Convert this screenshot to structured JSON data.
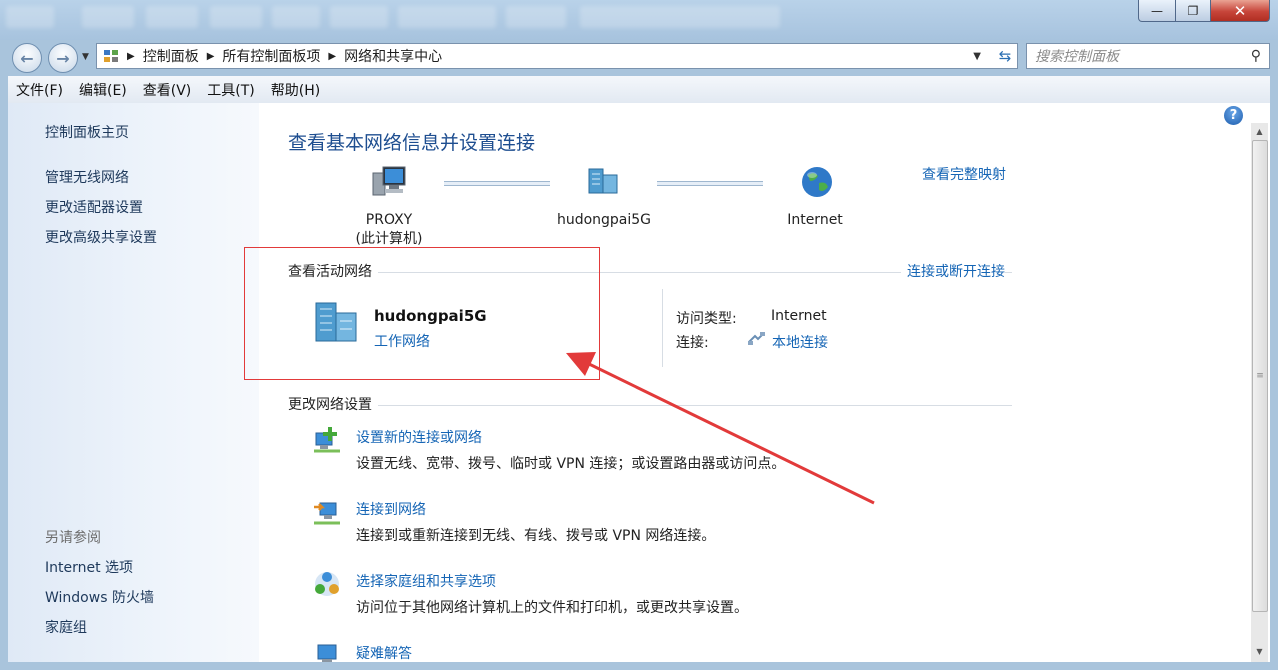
{
  "window": {
    "min_label": "—",
    "max_label": "❐",
    "close_label": "✕"
  },
  "nav": {
    "back_icon": "back-arrow-icon",
    "forward_icon": "forward-arrow-icon",
    "breadcrumbs": [
      "控制面板",
      "所有控制面板项",
      "网络和共享中心"
    ],
    "search_placeholder": "搜索控制面板"
  },
  "menu": [
    "文件(F)",
    "编辑(E)",
    "查看(V)",
    "工具(T)",
    "帮助(H)"
  ],
  "sidebar": {
    "home": "控制面板主页",
    "links": [
      "管理无线网络",
      "更改适配器设置",
      "更改高级共享设置"
    ],
    "see_also_heading": "另请参阅",
    "see_also": [
      "Internet 选项",
      "Windows 防火墙",
      "家庭组"
    ]
  },
  "main": {
    "title": "查看基本网络信息并设置连接",
    "full_map_link": "查看完整映射",
    "map_nodes": [
      {
        "name": "PROXY",
        "sub": "(此计算机)",
        "icon": "computer-icon"
      },
      {
        "name": "hudongpai5G",
        "sub": "",
        "icon": "network-building-icon"
      },
      {
        "name": "Internet",
        "sub": "",
        "icon": "globe-icon"
      }
    ],
    "active_section": {
      "label": "查看活动网络",
      "connect_link": "连接或断开连接",
      "network_name": "hudongpai5G",
      "network_category": "工作网络",
      "access_type_label": "访问类型:",
      "access_type_value": "Internet",
      "connections_label": "连接:",
      "connections_value": "本地连接"
    },
    "change_section": {
      "label": "更改网络设置",
      "tasks": [
        {
          "title": "设置新的连接或网络",
          "desc": "设置无线、宽带、拨号、临时或 VPN 连接；或设置路由器或访问点。",
          "icon": "new-connection-icon"
        },
        {
          "title": "连接到网络",
          "desc": "连接到或重新连接到无线、有线、拨号或 VPN 网络连接。",
          "icon": "connect-network-icon"
        },
        {
          "title": "选择家庭组和共享选项",
          "desc": "访问位于其他网络计算机上的文件和打印机，或更改共享设置。",
          "icon": "homegroup-icon"
        },
        {
          "title": "疑难解答",
          "desc": "",
          "icon": "troubleshoot-icon"
        }
      ]
    }
  },
  "colors": {
    "link": "#1565b5",
    "title": "#1e4e90",
    "annotation_red": "#e23a3a"
  }
}
